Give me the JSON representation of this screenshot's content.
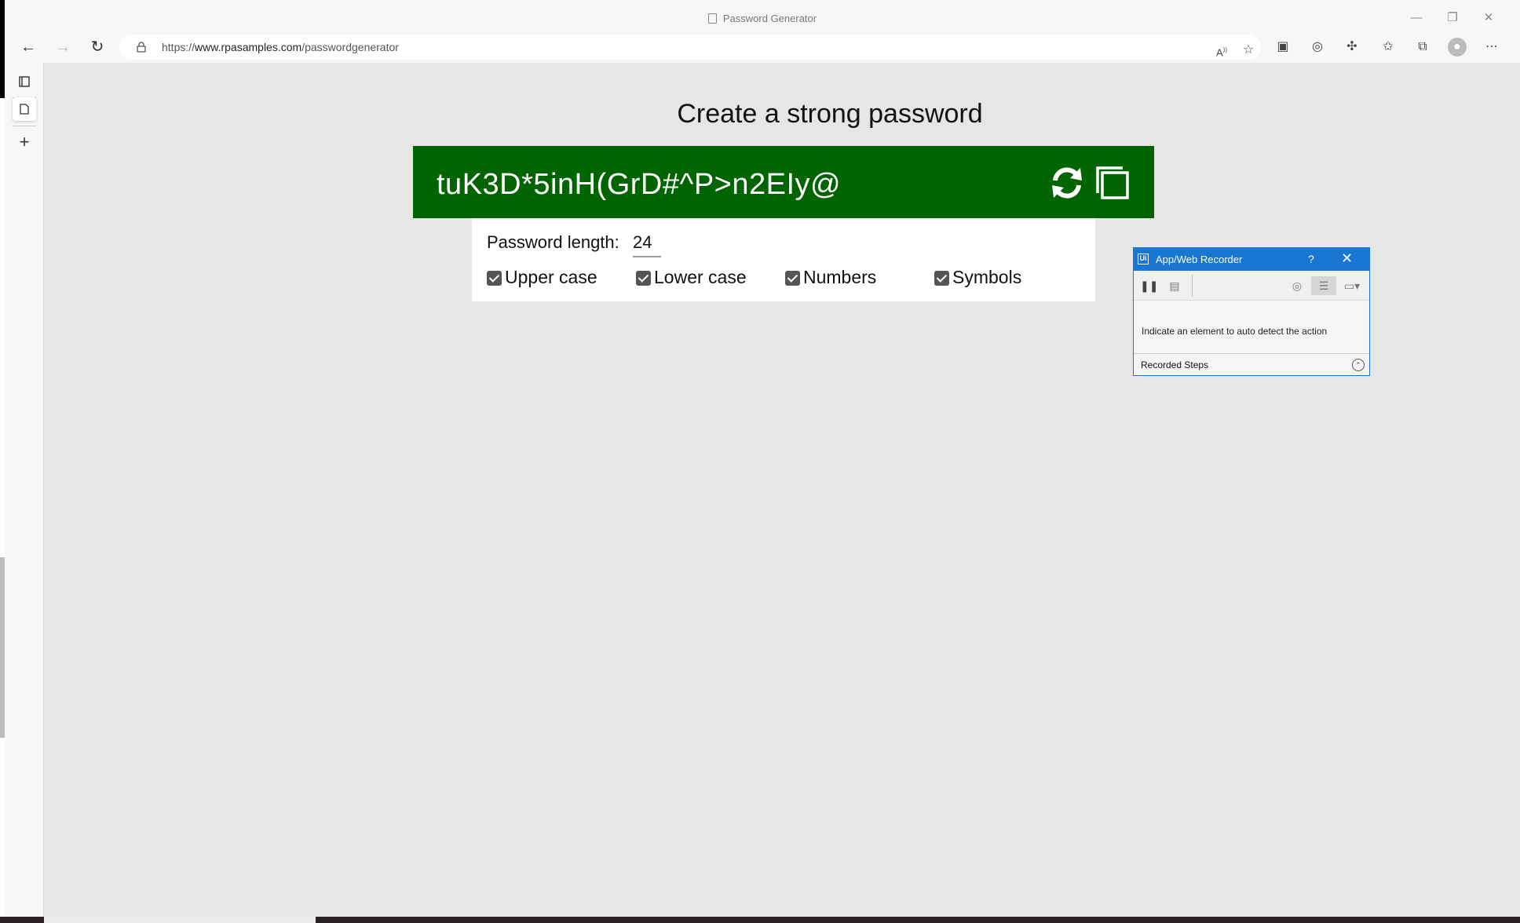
{
  "window": {
    "title": "Password Generator",
    "minimize_glyph": "—",
    "restore_glyph": "❐",
    "close_glyph": "✕"
  },
  "toolbar": {
    "back_glyph": "←",
    "forward_glyph": "→",
    "refresh_glyph": "↻",
    "url_prefix": "https://",
    "url_host": "www.rpasamples.com",
    "url_path": "/passwordgenerator",
    "icons": [
      "read-aloud-icon",
      "favorite-add-icon",
      "split-screen-icon",
      "tracking-icon",
      "extensions-icon",
      "favorites-icon",
      "collections-icon",
      "profile-icon",
      "more-icon"
    ],
    "more_glyph": "⋯"
  },
  "sidebar": {
    "plus_glyph": "+"
  },
  "page": {
    "heading": "Create a strong password",
    "password": "tuK3D*5inH(GrD#^P>n2EIy@",
    "length_label": "Password length:",
    "length_value": "24",
    "options": [
      {
        "label": "Upper case",
        "checked": true
      },
      {
        "label": "Lower case",
        "checked": true
      },
      {
        "label": "Numbers",
        "checked": true
      },
      {
        "label": "Symbols",
        "checked": true
      }
    ],
    "accent_color": "#006400"
  },
  "recorder": {
    "title": "App/Web Recorder",
    "logo": "Ui",
    "help": "?",
    "close": "✕",
    "message": "Indicate an element to auto detect the action",
    "steps_label": "Recorded Steps",
    "chevron": "⌃",
    "header_color": "#1976d2"
  }
}
